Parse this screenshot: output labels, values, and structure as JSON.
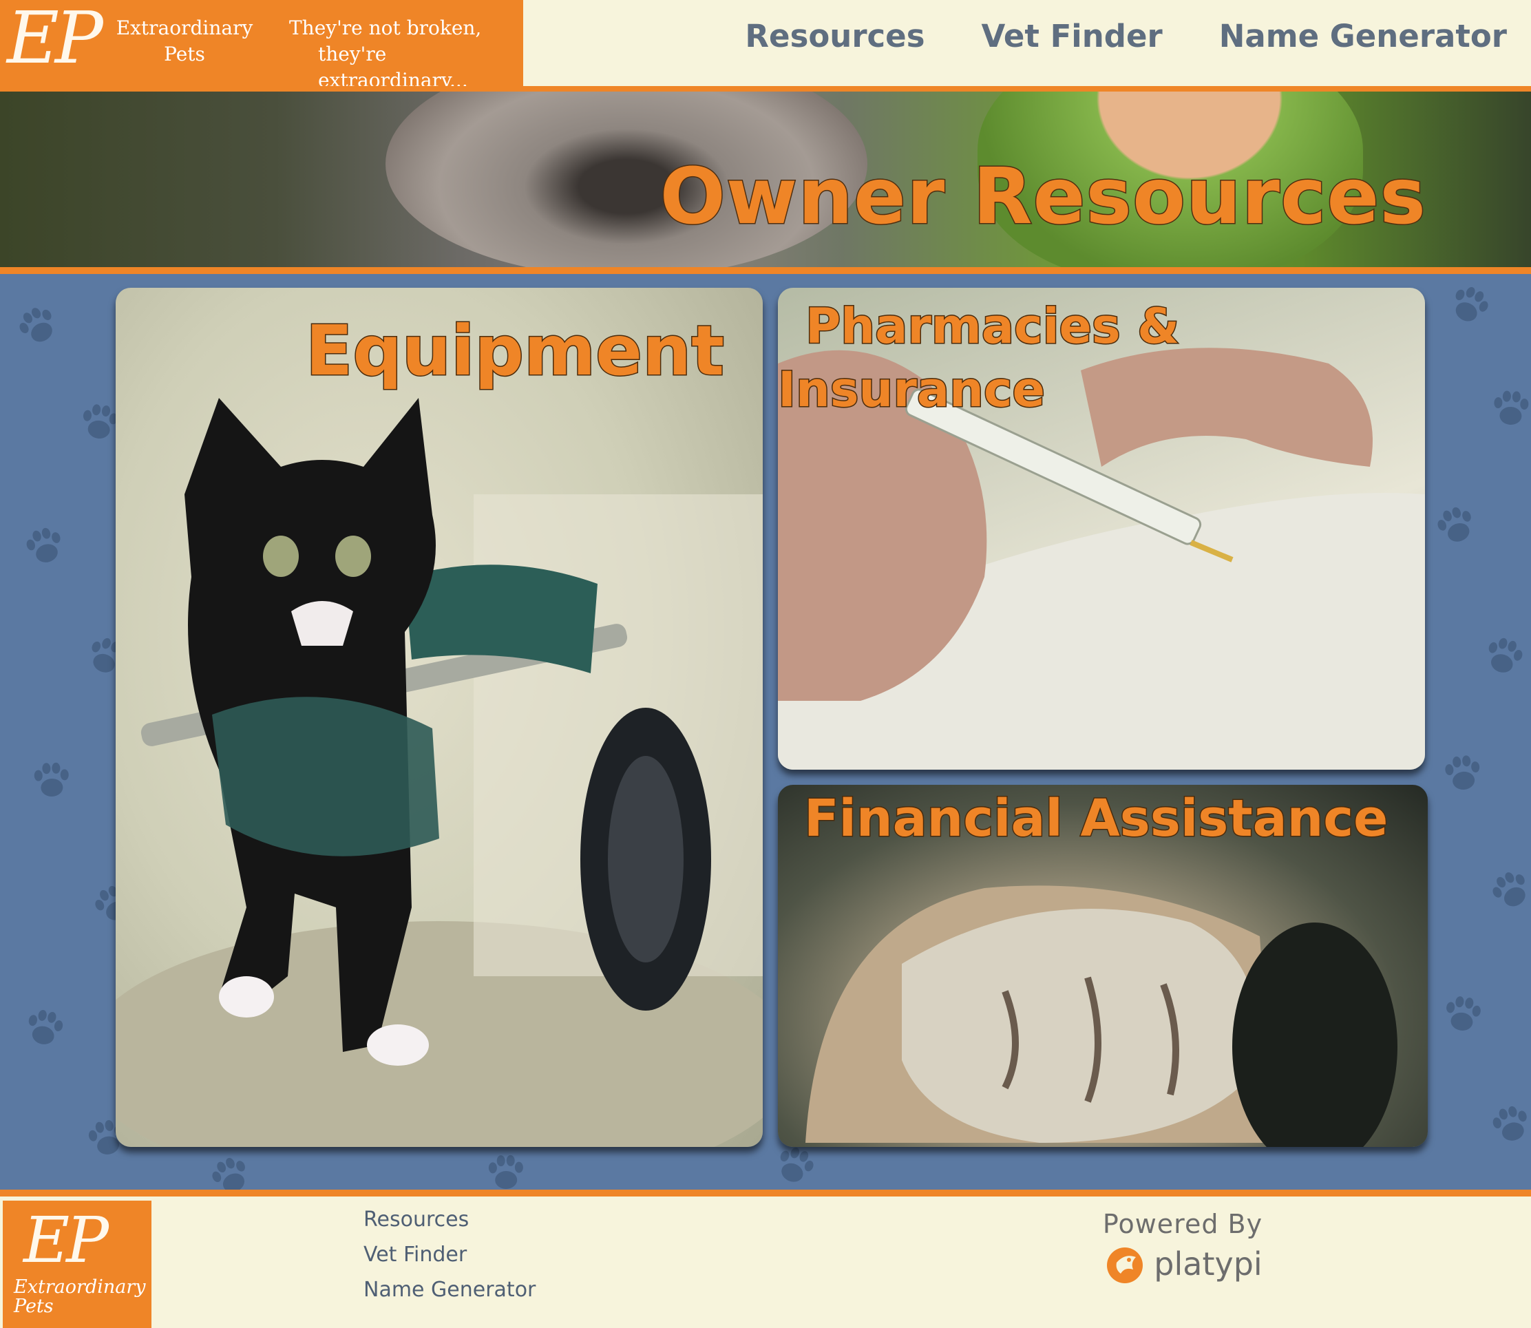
{
  "brand": {
    "logo_mark": "EP",
    "name": "Extraordinary\nPets",
    "tagline_line1": "They're not broken,",
    "tagline_line2": "they're extraordinary..."
  },
  "nav": {
    "items": [
      "Resources",
      "Vet Finder",
      "Name Generator"
    ]
  },
  "hero": {
    "title": "Owner Resources"
  },
  "tiles": {
    "equipment": "Equipment",
    "pharmacies_line1": "Pharmacies &",
    "pharmacies_line2": "Insurance",
    "financial": "Financial Assistance"
  },
  "footer": {
    "logo_mark": "EP",
    "logo_name": "Extraordinary\nPets",
    "links": [
      "Resources",
      "Vet Finder",
      "Name Generator"
    ],
    "powered_by": "Powered By",
    "platypi": "platypi"
  },
  "colors": {
    "accent": "#ef8527",
    "cream": "#f7f4dc",
    "content_bg": "#5b79a2",
    "nav_text": "#5f6e80"
  },
  "icons": [
    "paw-print-icon",
    "platypi-logo-icon"
  ]
}
